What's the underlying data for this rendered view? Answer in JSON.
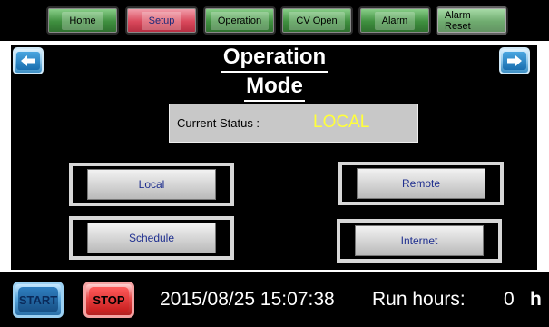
{
  "nav": {
    "buttons": [
      {
        "label": "Home",
        "state": "normal"
      },
      {
        "label": "Setup",
        "state": "active"
      },
      {
        "label": "Operation",
        "state": "normal"
      },
      {
        "label": "CV Open",
        "state": "normal"
      },
      {
        "label": "Alarm",
        "state": "normal"
      },
      {
        "label": "Alarm Reset",
        "state": "normal"
      }
    ]
  },
  "page": {
    "title_line1": "Operation",
    "title_line2": "Mode"
  },
  "status": {
    "label": "Current Status :",
    "value": "LOCAL",
    "value_color": "#ffff3a"
  },
  "modes": [
    {
      "label": "Local"
    },
    {
      "label": "Remote"
    },
    {
      "label": "Schedule"
    },
    {
      "label": "Internet"
    }
  ],
  "bottom": {
    "start_label": "START",
    "stop_label": "STOP",
    "datetime": "2015/08/25 15:07:38",
    "run_hours_label": "Run hours:",
    "run_hours_value": "0",
    "run_hours_unit": "h"
  },
  "icons": {
    "prev": "arrow-left-icon",
    "next": "arrow-right-icon"
  }
}
